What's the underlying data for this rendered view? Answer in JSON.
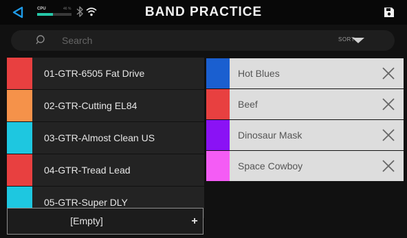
{
  "header": {
    "title": "BAND PRACTICE",
    "cpu_label": "CPU",
    "cpu_percent_text": "46 %",
    "cpu_fraction": 0.46
  },
  "search": {
    "placeholder": "Search",
    "sort_label": "SORT"
  },
  "presets": [
    {
      "label": "01-GTR-6505 Fat Drive",
      "color": "#e84040"
    },
    {
      "label": "02-GTR-Cutting EL84",
      "color": "#f5924a"
    },
    {
      "label": "03-GTR-Almost Clean US",
      "color": "#1ec7e0"
    },
    {
      "label": "04-GTR-Tread Lead",
      "color": "#e84040"
    },
    {
      "label": "05-GTR-Super DLY",
      "color": "#1ec7e0"
    }
  ],
  "empty_slot": {
    "label": "[Empty]",
    "add_symbol": "+"
  },
  "setlist": [
    {
      "label": "Hot Blues",
      "color": "#1a5fd0"
    },
    {
      "label": "Beef",
      "color": "#e84040"
    },
    {
      "label": "Dinosaur Mask",
      "color": "#8a12f5"
    },
    {
      "label": "Space Cowboy",
      "color": "#f45cf5"
    }
  ],
  "icons": {
    "back": "back-triangle-icon",
    "bluetooth": "bluetooth-icon",
    "wifi": "wifi-icon",
    "save": "save-icon",
    "search": "search-icon",
    "sort": "chevron-down-icon",
    "remove": "close-icon"
  },
  "colors": {
    "accent": "#1e9be8",
    "cpu_bar": "#25c7a8"
  }
}
